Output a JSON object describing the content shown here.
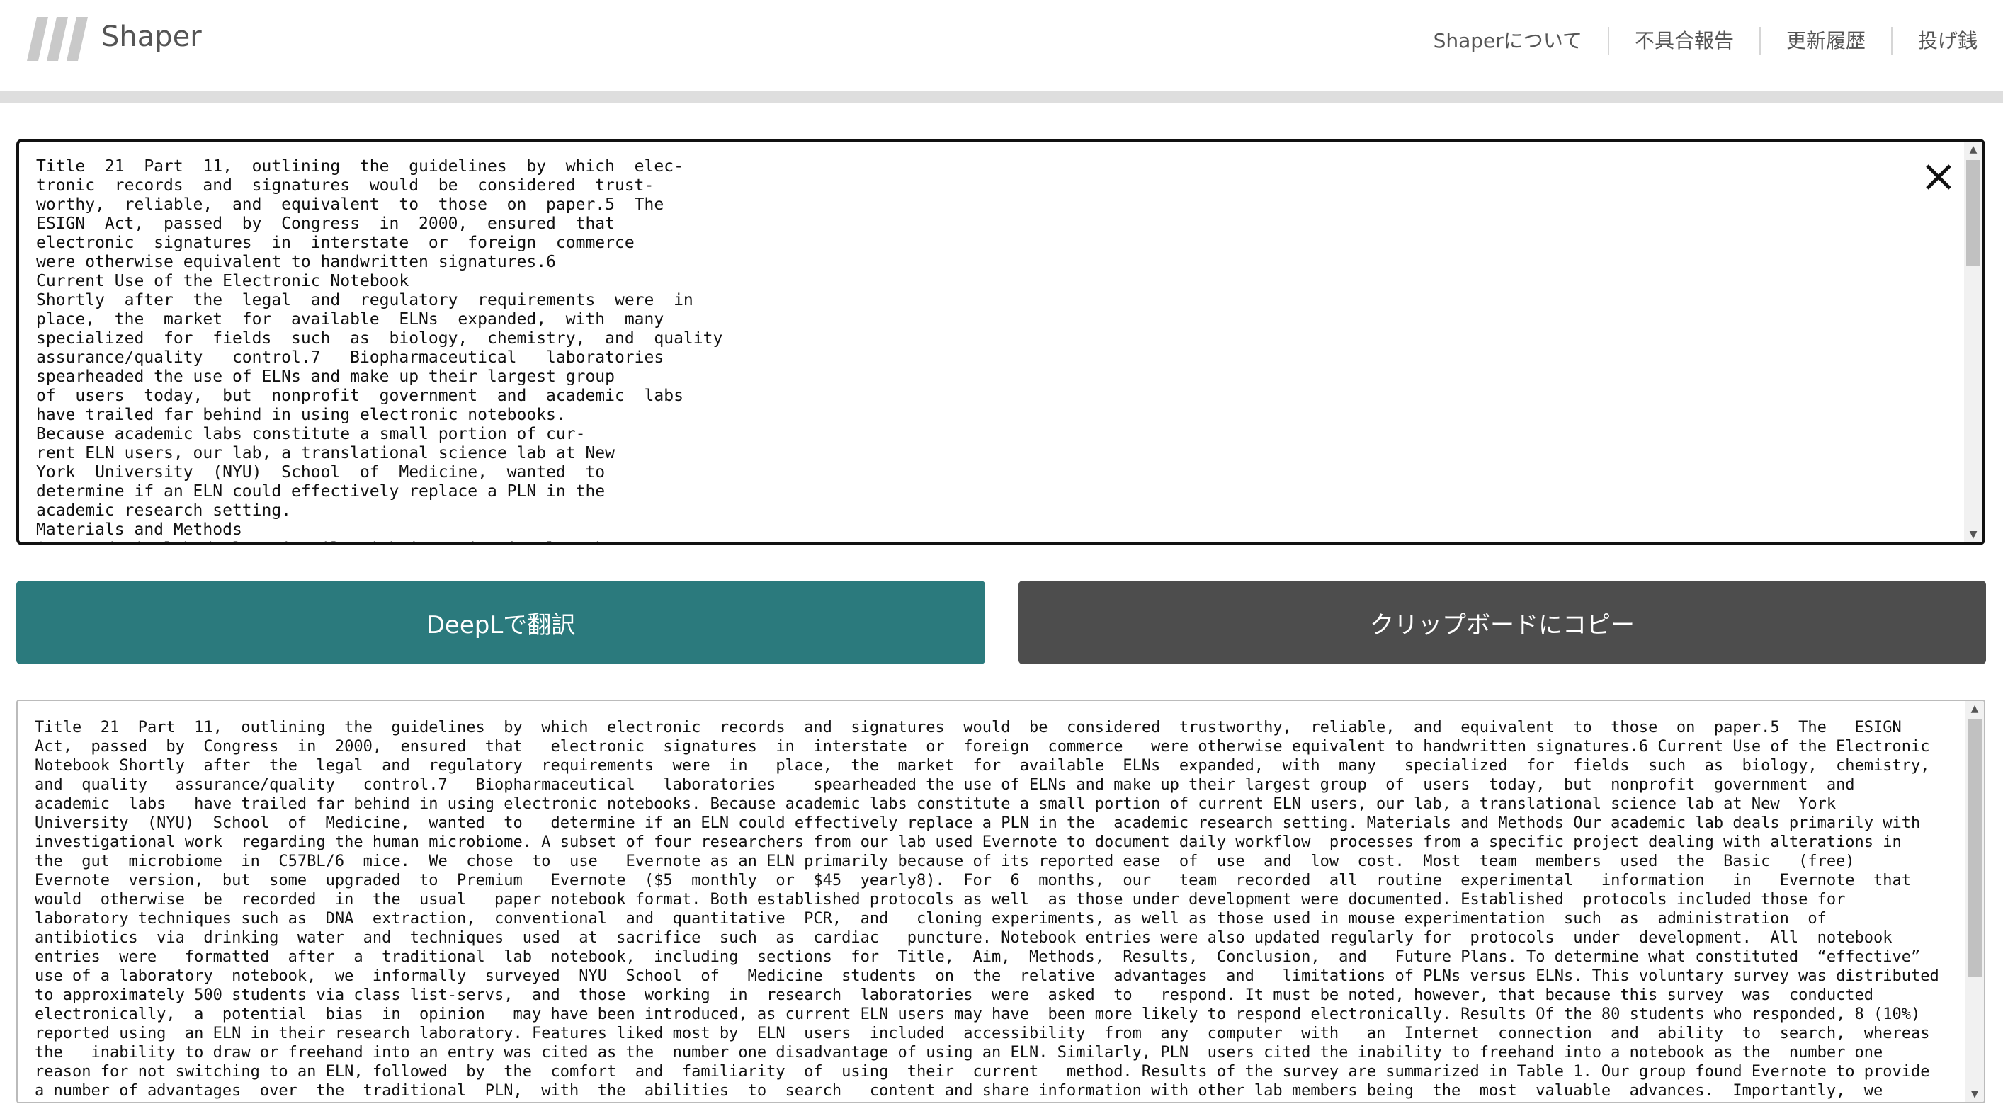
{
  "header": {
    "logo_text": "Shaper",
    "nav": [
      {
        "label": "Shaperについて"
      },
      {
        "label": "不具合報告"
      },
      {
        "label": "更新履歴"
      },
      {
        "label": "投げ銭"
      }
    ]
  },
  "input": {
    "text": "Title  21  Part  11,  outlining  the  guidelines  by  which  elec-\ntronic  records  and  signatures  would  be  considered  trust-\nworthy,  reliable,  and  equivalent  to  those  on  paper.5  The\nESIGN  Act,  passed  by  Congress  in  2000,  ensured  that\nelectronic  signatures  in  interstate  or  foreign  commerce\nwere otherwise equivalent to handwritten signatures.6\nCurrent Use of the Electronic Notebook\nShortly  after  the  legal  and  regulatory  requirements  were  in\nplace,  the  market  for  available  ELNs  expanded,  with  many\nspecialized  for  fields  such  as  biology,  chemistry,  and  quality\nassurance/quality   control.7   Biopharmaceutical   laboratories\nspearheaded the use of ELNs and make up their largest group\nof  users  today,  but  nonprofit  government  and  academic  labs\nhave trailed far behind in using electronic notebooks.\nBecause academic labs constitute a small portion of cur-\nrent ELN users, our lab, a translational science lab at New\nYork  University  (NYU)  School  of  Medicine,  wanted  to\ndetermine if an ELN could effectively replace a PLN in the\nacademic research setting.\nMaterials and Methods\nOur academic lab deals primarily with investigational work"
  },
  "buttons": {
    "translate": "DeepLで翻訳",
    "copy": "クリップボードにコピー"
  },
  "output": {
    "text": "Title  21  Part  11,  outlining  the  guidelines  by  which  electronic  records  and  signatures  would  be  considered  trustworthy,  reliable,  and  equivalent  to  those  on  paper.5  The   ESIGN\nAct,  passed  by  Congress  in  2000,  ensured  that   electronic  signatures  in  interstate  or  foreign  commerce   were otherwise equivalent to handwritten signatures.6 Current Use of the Electronic\nNotebook Shortly  after  the  legal  and  regulatory  requirements  were  in   place,  the  market  for  available  ELNs  expanded,  with  many   specialized  for  fields  such  as  biology,  chemistry,\nand  quality   assurance/quality   control.7   Biopharmaceutical   laboratories    spearheaded the use of ELNs and make up their largest group  of  users  today,  but  nonprofit  government  and\nacademic  labs   have trailed far behind in using electronic notebooks. Because academic labs constitute a small portion of current ELN users, our lab, a translational science lab at New  York\nUniversity  (NYU)  School  of  Medicine,  wanted  to   determine if an ELN could effectively replace a PLN in the  academic research setting. Materials and Methods Our academic lab deals primarily with\ninvestigational work  regarding the human microbiome. A subset of four researchers from our lab used Evernote to document daily workflow  processes from a specific project dealing with alterations in\nthe  gut  microbiome  in  C57BL/6  mice.  We  chose  to  use   Evernote as an ELN primarily because of its reported ease  of  use  and  low  cost.  Most  team  members  used  the  Basic   (free)\nEvernote  version,  but  some  upgraded  to  Premium   Evernote  ($5  monthly  or  $45  yearly8).  For  6  months,  our   team  recorded  all  routine  experimental   information   in   Evernote  that\nwould  otherwise  be  recorded  in  the  usual   paper notebook format. Both established protocols as well  as those under development were documented. Established  protocols included those for\nlaboratory techniques such as  DNA  extraction,  conventional  and  quantitative  PCR,  and   cloning experiments, as well as those used in mouse experimentation  such  as  administration  of\nantibiotics  via  drinking  water  and  techniques  used  at  sacrifice  such  as  cardiac   puncture. Notebook entries were also updated regularly for  protocols  under  development.  All  notebook\nentries  were   formatted  after  a  traditional  lab  notebook,  including  sections  for  Title,  Aim,  Methods,  Results,  Conclusion,  and   Future Plans. To determine what constituted  “effective”\nuse of a laboratory  notebook,  we  informally  surveyed  NYU  School  of   Medicine  students  on  the  relative  advantages  and   limitations of PLNs versus ELNs. This voluntary survey was distributed\nto approximately 500 students via class list-servs,  and  those  working  in  research  laboratories  were  asked  to   respond. It must be noted, however, that because this survey  was  conducted\nelectronically,  a  potential  bias  in  opinion   may have been introduced, as current ELN users may have  been more likely to respond electronically. Results Of the 80 students who responded, 8 (10%)\nreported using  an ELN in their research laboratory. Features liked most by  ELN  users  included  accessibility  from  any  computer  with   an  Internet  connection  and  ability  to  search,  whereas\nthe   inability to draw or freehand into an entry was cited as the  number one disadvantage of using an ELN. Similarly, PLN  users cited the inability to freehand into a notebook as the  number one\nreason for not switching to an ELN, followed  by  the  comfort  and  familiarity  of  using  their  current   method. Results of the survey are summarized in Table 1. Our group found Evernote to provide\na number of advantages  over  the  traditional  PLN,  with  the  abilities  to  search   content and share information with other lab members being  the  most  valuable  advances.  Importantly,  we"
  },
  "colors": {
    "translate_button": "#2b7a7d",
    "copy_button": "#4d4d4d",
    "header_bar": "#dedede"
  }
}
